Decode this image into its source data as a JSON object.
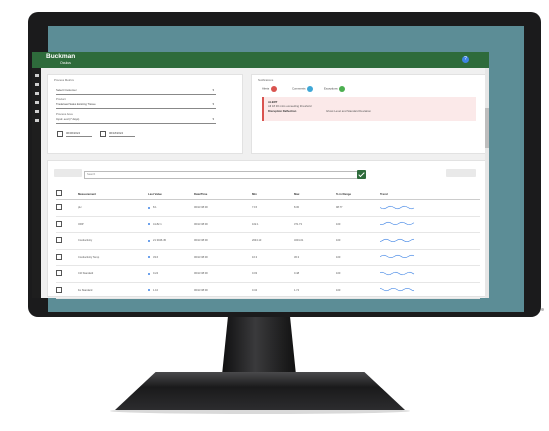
{
  "header": {
    "brand": "Buckman",
    "brand_sub": "Oculus",
    "help_icon": "help-icon"
  },
  "sidebar": {
    "icons": [
      "menu-icon",
      "home-icon",
      "folder-icon",
      "list-icon",
      "chevron-icon",
      "edit-icon"
    ]
  },
  "filters": {
    "section_title": "Process Metrics",
    "field1": {
      "value": "Select Customer"
    },
    "field2": {
      "label": "Product",
      "value": "Tradeload Sales Existing Tissue"
    },
    "field3": {
      "label": "Process Area",
      "value": "Input: eod (7 days)"
    },
    "start_date": "06/06/2024",
    "end_date": "06/18/2024"
  },
  "notifications": {
    "section_title": "Notifications",
    "chips": [
      {
        "label": "Alerts",
        "color": "#d9534f"
      },
      {
        "label": "Comments",
        "color": "#3fa7d6"
      },
      {
        "label": "Exceptions",
        "color": "#4caf50"
      }
    ],
    "alert": {
      "title": "ALERT",
      "line1": "All 18 30 mins exceeding threshold",
      "key": "Disruption Deflection",
      "value": "Ghost Level and Standard Deviation"
    }
  },
  "table": {
    "search_placeholder": "Search",
    "left_button": "",
    "right_button": "",
    "columns": [
      "",
      "Measurement",
      "Last Value",
      "Date/Time",
      "Min",
      "Max",
      "% in Range",
      "Trend"
    ],
    "rows": [
      {
        "measurement": "pH",
        "last": "8.1",
        "date": "06/13 08:00",
        "min": "7.15",
        "max": "8.30",
        "range": "98.77"
      },
      {
        "measurement": "ORP",
        "last": "41.82.1",
        "date": "06/13 08:00",
        "min": "102.1",
        "max": "371.73",
        "range": "100"
      },
      {
        "measurement": "Conductivity",
        "last": "21 3046.45",
        "date": "06/13 08:00",
        "min": "2043.13",
        "max": "3201.01",
        "range": "100"
      },
      {
        "measurement": "Conductivity Temp",
        "last": "33.6",
        "date": "06/13 08:00",
        "min": "16.3",
        "max": "36.3",
        "range": "100"
      },
      {
        "measurement": "Cl2 Standard",
        "last": "0.24",
        "date": "06/13 08:00",
        "min": "0.03",
        "max": "0.48",
        "range": "100"
      },
      {
        "measurement": "Fe Standard",
        "last": "1.10",
        "date": "06/13 08:00",
        "min": "0.34",
        "max": "1.74",
        "range": "100"
      }
    ]
  }
}
